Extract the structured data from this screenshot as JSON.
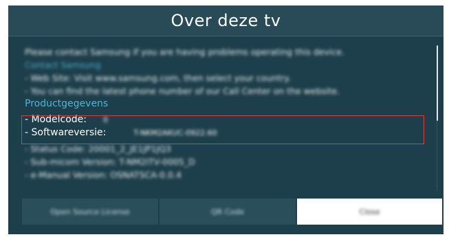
{
  "dialog": {
    "title": "Over deze tv",
    "intro": "Please contact Samsung if you are having problems operating this device.",
    "contact_link": "Contact Samsung",
    "bullets_top": [
      "- Web Site: Visit www.samsung.com, then select your country.",
      "- You can find the latest phone number of our Call Center on the website."
    ],
    "section_heading": "Productgegevens",
    "modelcode_label": "- Modelcode:",
    "modelcode_value": "0",
    "software_label": "- Softwareversie:",
    "software_value": "T-NKM2AKUC-0922.60",
    "bullets_bottom": [
      "- Status Code: 20001_2_JE1JP1JQ3",
      "- Sub-micom Version: T-NM2ITV-0005_D",
      "- e-Manual Version: OSNATSCA-0.0.4"
    ],
    "buttons": {
      "open_source": "Open Source License",
      "qr_code": "QR Code",
      "close": "Close"
    }
  },
  "colors": {
    "dialog_bg": "#1d3f4b",
    "title_bar_bg": "#284b57",
    "link": "#4fb6d6",
    "highlight_border": "#d0453c"
  }
}
